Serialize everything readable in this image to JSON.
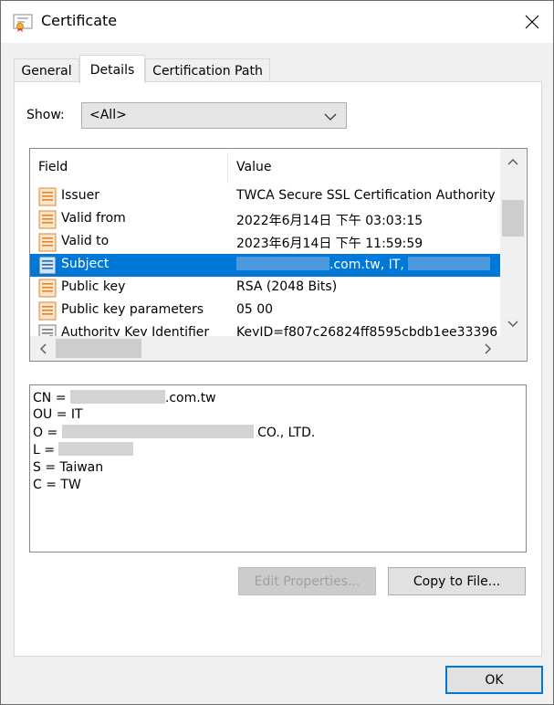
{
  "window": {
    "title": "Certificate",
    "icon": "certificate-icon"
  },
  "tabs": [
    {
      "label": "General",
      "active": false
    },
    {
      "label": "Details",
      "active": true
    },
    {
      "label": "Certification Path",
      "active": false
    }
  ],
  "show": {
    "label": "Show:",
    "value": "<All>"
  },
  "list": {
    "columns": [
      "Field",
      "Value"
    ],
    "rows": [
      {
        "field": "Issuer",
        "value": "TWCA Secure SSL Certification Authority",
        "selected": false
      },
      {
        "field": "Valid from",
        "value": "2022年6月14日 下午 03:03:15",
        "selected": false
      },
      {
        "field": "Valid to",
        "value": "2023年6月14日 下午 11:59:59",
        "selected": false
      },
      {
        "field": "Subject",
        "value_visible": ".com.tw, IT, ",
        "selected": true
      },
      {
        "field": "Public key",
        "value": "RSA (2048 Bits)",
        "selected": false
      },
      {
        "field": "Public key parameters",
        "value": "05 00",
        "selected": false
      },
      {
        "field": "Authority Key Identifier",
        "value": "KeyID=f807c26824ff8595cbdb1ee33396",
        "selected": false
      }
    ]
  },
  "detail": {
    "cn_prefix": "CN = ",
    "cn_suffix": ".com.tw",
    "ou": "OU = IT",
    "o_prefix": "O = ",
    "o_suffix": " CO., LTD.",
    "l_prefix": "L = ",
    "s": "S = Taiwan",
    "c": "C = TW"
  },
  "buttons": {
    "edit_properties": "Edit Properties...",
    "copy_to_file": "Copy to File...",
    "ok": "OK"
  },
  "colors": {
    "selection": "#0078d7",
    "redaction": "#d3d3d3"
  }
}
